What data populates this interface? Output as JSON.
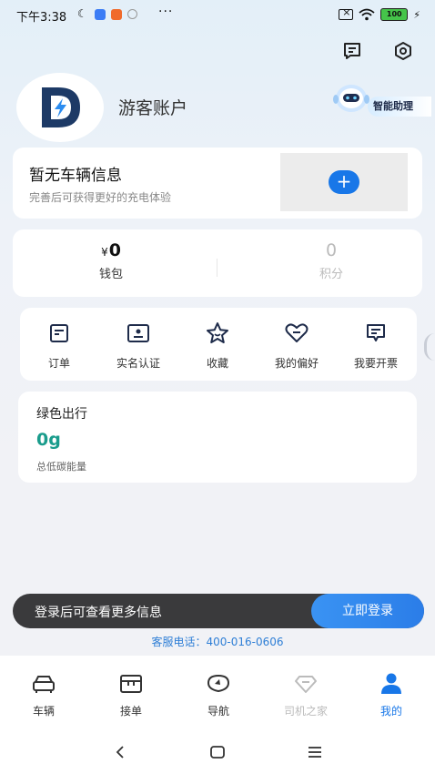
{
  "status_bar": {
    "time": "下午3:38",
    "battery": "100"
  },
  "profile": {
    "name": "游客账户",
    "assistant_label": "智能助理"
  },
  "vehicle": {
    "title": "暂无车辆信息",
    "subtitle": "完善后可获得更好的充电体验",
    "add_symbol": "+"
  },
  "wallet": {
    "currency": "¥",
    "balance": "0",
    "balance_label": "钱包",
    "points": "0",
    "points_label": "积分"
  },
  "menu": [
    {
      "label": "订单",
      "icon": "order-icon"
    },
    {
      "label": "实名认证",
      "icon": "id-card-icon"
    },
    {
      "label": "收藏",
      "icon": "star-icon"
    },
    {
      "label": "我的偏好",
      "icon": "heart-icon"
    },
    {
      "label": "我要开票",
      "icon": "invoice-icon"
    }
  ],
  "green": {
    "title": "绿色出行",
    "value": "0g",
    "subtitle": "总低碳能量"
  },
  "login": {
    "prompt": "登录后可查看更多信息",
    "button": "立即登录"
  },
  "service": "客服电话：400-016-0606",
  "tabs": [
    {
      "label": "车辆",
      "icon": "car-icon",
      "state": "normal"
    },
    {
      "label": "接单",
      "icon": "orders-box-icon",
      "state": "normal"
    },
    {
      "label": "导航",
      "icon": "navigation-icon",
      "state": "normal"
    },
    {
      "label": "司机之家",
      "icon": "driver-home-icon",
      "state": "disabled"
    },
    {
      "label": "我的",
      "icon": "person-icon",
      "state": "active"
    }
  ],
  "colors": {
    "accent": "#1877e8",
    "green_value": "#1a9c8c",
    "login_bar": "#3a3a3c"
  }
}
